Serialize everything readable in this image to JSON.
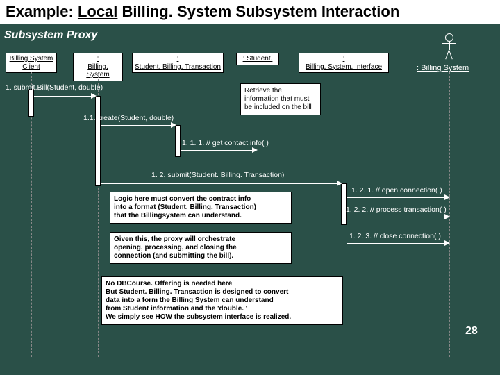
{
  "title_prefix": "Example: ",
  "title_local": "Local",
  "title_rest": " Billing. System Subsystem Interaction",
  "subtitle": "Subsystem Proxy",
  "lifelines": {
    "client": "Billing System\nClient",
    "billingsystem": ":\nBilling. System",
    "sbt": ":\nStudent. Billing. Transaction",
    "student": ": Student.",
    "bsi": ":\nBilling. System. Interface"
  },
  "actor_label": ": Billing System",
  "messages": {
    "m1": "1. submit.Bill(Student, double)",
    "m11": "1.1. create(Student, double)",
    "m111": "1. 1. 1. // get contact info( )",
    "m12": "1. 2. submit(Student. Billing. Transaction)",
    "m121": "1. 2. 1. // open connection( )",
    "m122": "1. 2. 2. // process transaction( )",
    "m123": "1. 2. 3. // close connection( )"
  },
  "notes": {
    "n1": "Retrieve the\ninformation that must\nbe included on the bill",
    "n2": "Logic here must convert the contract info\ninto a format (Student. Billing. Transaction)\nthat the Billingsystem can understand.",
    "n3": "Given this, the proxy will orchestrate\nopening, processing, and closing the\nconnection (and submitting the bill).",
    "n4": "No DBCourse. Offering is needed here\nBut Student. Billing. Transaction is designed to convert\n  data into a form the Billing System can understand\n  from Student information and the 'double. '\nWe simply see HOW the subsystem interface is realized."
  },
  "pagenum": "28"
}
